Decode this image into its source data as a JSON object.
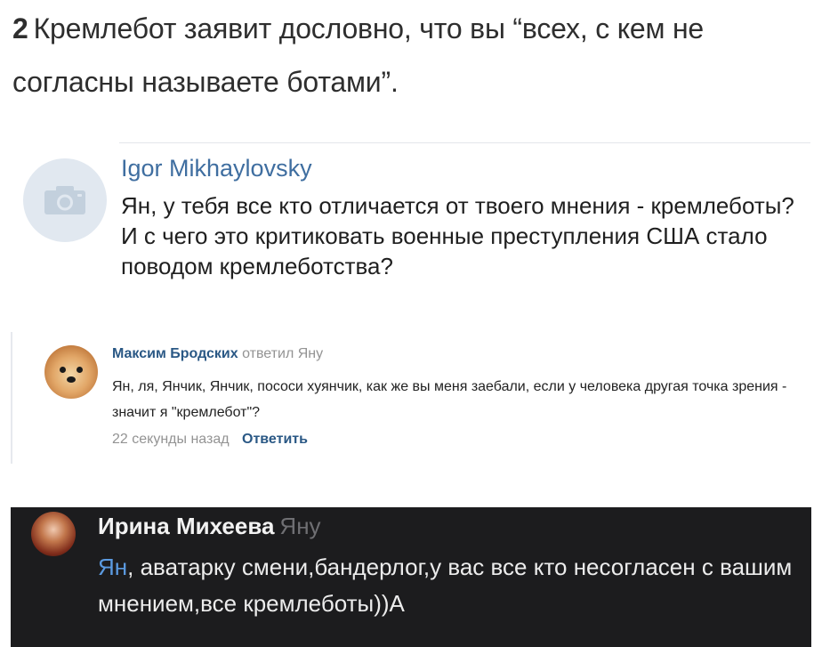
{
  "headline": {
    "number": "2",
    "text": "Кремлебот заявит дословно, что вы “всех, с кем не согласны называете ботами”."
  },
  "comment1": {
    "avatar_icon": "camera-icon",
    "author": "Igor Mikhaylovsky",
    "text": "Ян, у тебя все кто отличается от твоего мнения - кремлеботы? И с чего это критиковать военные преступления США стало поводом кремлеботства?"
  },
  "comment2": {
    "author": "Максим Бродских",
    "replied_to": "ответил Яну",
    "text": "Ян, ля, Янчик, Янчик, пососи хуянчик, как же вы меня заебали, если у человека другая точка зрения - значит я \"кремлебот\"?",
    "time": "22 секунды назад",
    "reply_label": "Ответить"
  },
  "comment3": {
    "author": "Ирина Михеева",
    "to": "Яну",
    "mention": "Ян",
    "text": ", аватарку смени,бандерлог,у вас все кто несогласен с вашим мнением,все кремлеботы))А"
  },
  "colors": {
    "link_blue": "#3f6ea0",
    "vk_blue": "#2a5885",
    "dark_bg": "#1c1c1e",
    "mention_blue": "#5b9ae0"
  }
}
